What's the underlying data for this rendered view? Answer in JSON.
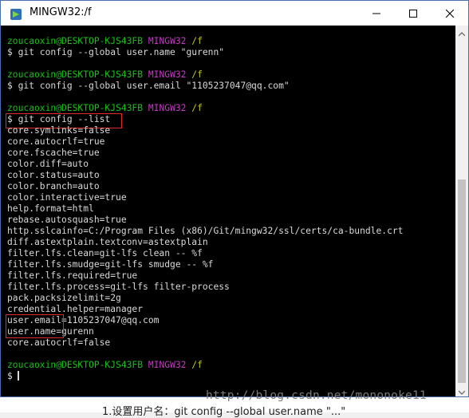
{
  "window": {
    "title": "MINGW32:/f"
  },
  "prompt": {
    "user_host": "zoucaoxin@DESKTOP-KJS43FB",
    "system": "MINGW32",
    "path": "/f"
  },
  "session": [
    {
      "command": "$ git config --global user.name \"gurenn\""
    },
    {
      "command": "$ git config --global user.email \"1105237047@qq.com\""
    },
    {
      "command": "$ git config --list",
      "output": [
        "core.symlinks=false",
        "core.autocrlf=true",
        "core.fscache=true",
        "color.diff=auto",
        "color.status=auto",
        "color.branch=auto",
        "color.interactive=true",
        "help.format=html",
        "rebase.autosquash=true",
        "http.sslcainfo=C:/Program Files (x86)/Git/mingw32/ssl/certs/ca-bundle.crt",
        "diff.astextplain.textconv=astextplain",
        "filter.lfs.clean=git-lfs clean -- %f",
        "filter.lfs.smudge=git-lfs smudge -- %f",
        "filter.lfs.required=true",
        "filter.lfs.process=git-lfs filter-process",
        "pack.packsizelimit=2g",
        "credential.helper=manager",
        "user.email=1105237047@qq.com",
        "user.name=gurenn",
        "core.autocrlf=false"
      ]
    }
  ],
  "final_prompt": "$",
  "watermark": "http://blog.csdn.net/mononoke11",
  "underlay_text": "1.设置用户名：git config --global user.name \"...\"",
  "colors": {
    "user_host": "#19c119",
    "system": "#c738c7",
    "path": "#c5c51f",
    "text": "#d9d9d9",
    "highlight": "#e02a2a"
  },
  "icons": {
    "app": "mingw-app-icon",
    "minimize": "minimize-icon",
    "maximize": "maximize-icon",
    "close": "close-icon",
    "scroll_up": "chevron-up-icon",
    "scroll_down": "chevron-down-icon"
  }
}
